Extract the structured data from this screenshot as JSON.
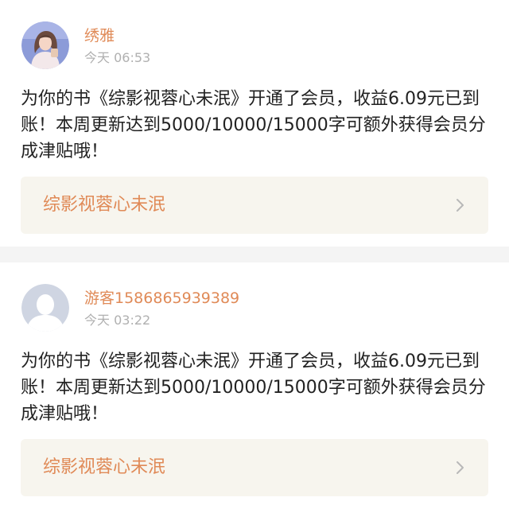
{
  "notifications": [
    {
      "username": "绣雅",
      "time": "今天 06:53",
      "avatar_icon": "user-photo-avatar",
      "message": "为你的书《综影视蓉心未泯》开通了会员，收益6.09元已到账！本周更新达到5000/10000/15000字可额外获得会员分成津贴哦！",
      "book_title": "综影视蓉心未泯"
    },
    {
      "username": "游客1586865939389",
      "time": "今天 03:22",
      "avatar_icon": "default-user-avatar",
      "message": "为你的书《综影视蓉心未泯》开通了会员，收益6.09元已到账！本周更新达到5000/10000/15000字可额外获得会员分成津贴哦！",
      "book_title": "综影视蓉心未泯"
    }
  ],
  "colors": {
    "accent": "#e08a57",
    "muted": "#b0b0b0",
    "text": "#222222",
    "link_bg": "#f7f5ee",
    "divider": "#f4f4f4"
  }
}
